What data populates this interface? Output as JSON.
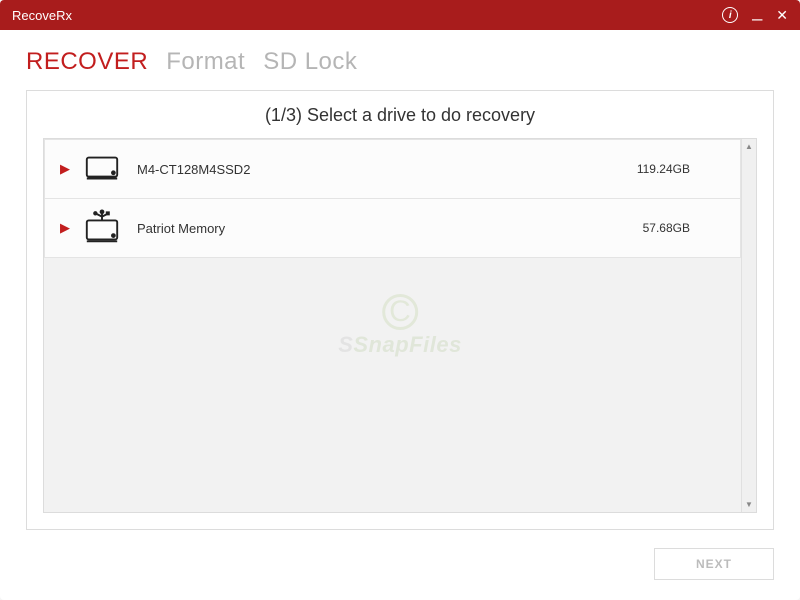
{
  "app": {
    "title": "RecoveRx"
  },
  "tabs": {
    "recover": "RECOVER",
    "format": "Format",
    "sdlock": "SD Lock"
  },
  "step": {
    "title": "(1/3) Select a drive to do recovery"
  },
  "drives": [
    {
      "name": "M4-CT128M4SSD2",
      "size": "119.24GB",
      "type": "ssd"
    },
    {
      "name": "Patriot Memory",
      "size": "57.68GB",
      "type": "usb"
    }
  ],
  "buttons": {
    "next": "NEXT"
  },
  "watermark": {
    "text": "SnapFiles"
  }
}
